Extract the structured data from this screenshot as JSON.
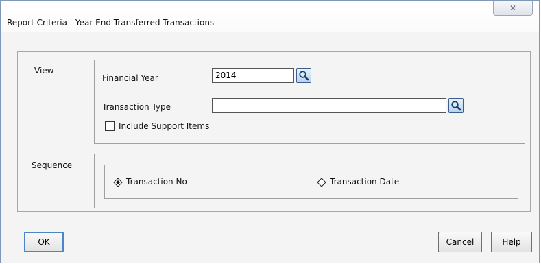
{
  "window": {
    "title": "Report Criteria - Year End Transferred Transactions",
    "close_glyph": "✕"
  },
  "view": {
    "section_label": "View",
    "financial_year_label": "Financial Year",
    "financial_year_value": "2014",
    "transaction_type_label": "Transaction Type",
    "transaction_type_value": "",
    "include_support_label": "Include Support Items",
    "include_support_checked": false
  },
  "sequence": {
    "section_label": "Sequence",
    "options": [
      {
        "label": "Transaction No",
        "selected": true
      },
      {
        "label": "Transaction Date",
        "selected": false
      }
    ]
  },
  "buttons": {
    "ok": "OK",
    "cancel": "Cancel",
    "help": "Help"
  },
  "icons": {
    "lookup": "magnifier-icon",
    "close": "close-icon"
  }
}
